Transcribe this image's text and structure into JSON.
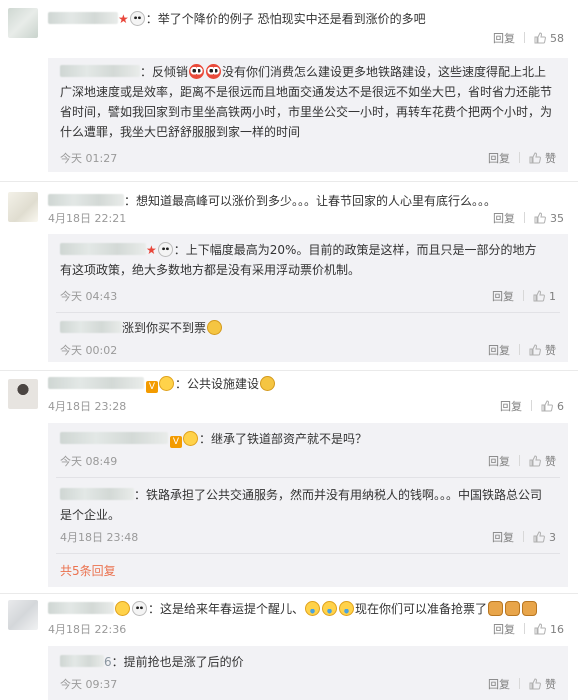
{
  "thumb_color": "#b8b8b8",
  "accent_color": "#eb7350",
  "comments": [
    {
      "text": "：举了个降价的例子 恐怕现实中还是看到涨价的多吧",
      "reply": "回复",
      "likes": "58",
      "replies": [
        {
          "text": "：反倾销",
          "text2": "没有你们消费怎么建设更多地铁路建设，这些速度得配上北上",
          "text3": "广深地速度或是效率，距离不是很远而且地面交通发达不是很远不如坐大巴，省时省力还能节",
          "text4": "省时间，譬如我回家到市里坐高铁两小时，市里坐公交一小时，再转车花费个把两个小时，为",
          "text5": "什么遭罪，我坐大巴舒舒服服到家一样的时间",
          "time": "今天 01:27",
          "reply": "回复",
          "like": "赞"
        }
      ]
    },
    {
      "text": "：想知道最高峰可以涨价到多少。。。让春节回家的人心里有底行么。。。",
      "time": "4月18日 22:21",
      "reply": "回复",
      "likes": "35",
      "replies": [
        {
          "text": "：上下幅度最高为20%。目前的政策是这样，而且只是一部分的地方",
          "text2": "有这项政策，绝大多数地方都是没有采用浮动票价机制。",
          "time": "今天 04:43",
          "reply": "回复",
          "likes": "1"
        },
        {
          "text": "涨到你买不到票",
          "time": "今天 00:02",
          "reply": "回复",
          "like": "赞"
        }
      ]
    },
    {
      "text": "：公共设施建设",
      "time": "4月18日 23:28",
      "reply": "回复",
      "likes": "6",
      "replies": [
        {
          "text": "：继承了铁道部资产就不是吗？",
          "time": "今天 08:49",
          "reply": "回复",
          "like": "赞"
        },
        {
          "text": "：铁路承担了公共交通服务，然而并没有用纳税人的钱啊。。。中国铁路总公司",
          "text2": "是个企业。",
          "time": "4月18日 23:48",
          "reply": "回复",
          "likes": "3"
        }
      ],
      "more": "共5条回复"
    },
    {
      "text": "：这是给来年春运提个醒儿、",
      "text_after": "现在你们可以准备抢票了",
      "time": "4月18日 22:36",
      "reply": "回复",
      "likes": "16",
      "replies": [
        {
          "name_tail": "6",
          "text": "：提前抢也是涨了后的价",
          "time": "今天 09:37",
          "reply": "回复",
          "like": "赞"
        }
      ]
    }
  ]
}
